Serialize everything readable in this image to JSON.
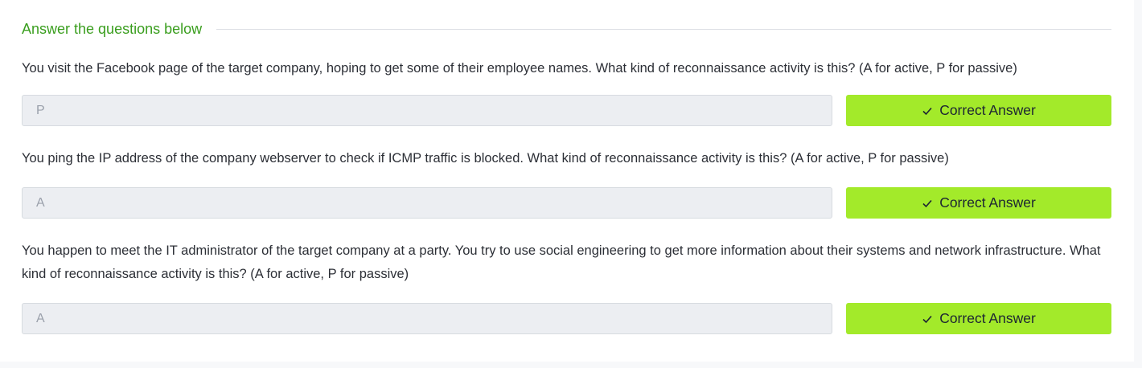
{
  "section": {
    "title": "Answer the questions below"
  },
  "questions": [
    {
      "text": "You visit the Facebook page of the target company, hoping to get some of their employee names. What kind of reconnaissance activity is this? (A for active, P for passive)",
      "answer": "P",
      "button_label": "Correct Answer",
      "button_icon": "check-icon"
    },
    {
      "text": "You ping the IP address of the company webserver to check if ICMP traffic is blocked. What kind of reconnaissance activity is this? (A for active, P for passive)",
      "answer": "A",
      "button_label": "Correct Answer",
      "button_icon": "check-icon"
    },
    {
      "text": "You happen to meet the IT administrator of the target company at a party. You try to use social engineering to get more information about their systems and network infrastructure. What kind of reconnaissance activity is this? (A for active, P for passive)",
      "answer": "A",
      "button_label": "Correct Answer",
      "button_icon": "check-icon"
    }
  ],
  "colors": {
    "accent_green_text": "#3a9e1e",
    "correct_button": "#a3ea2a",
    "input_background": "#eceef2"
  }
}
